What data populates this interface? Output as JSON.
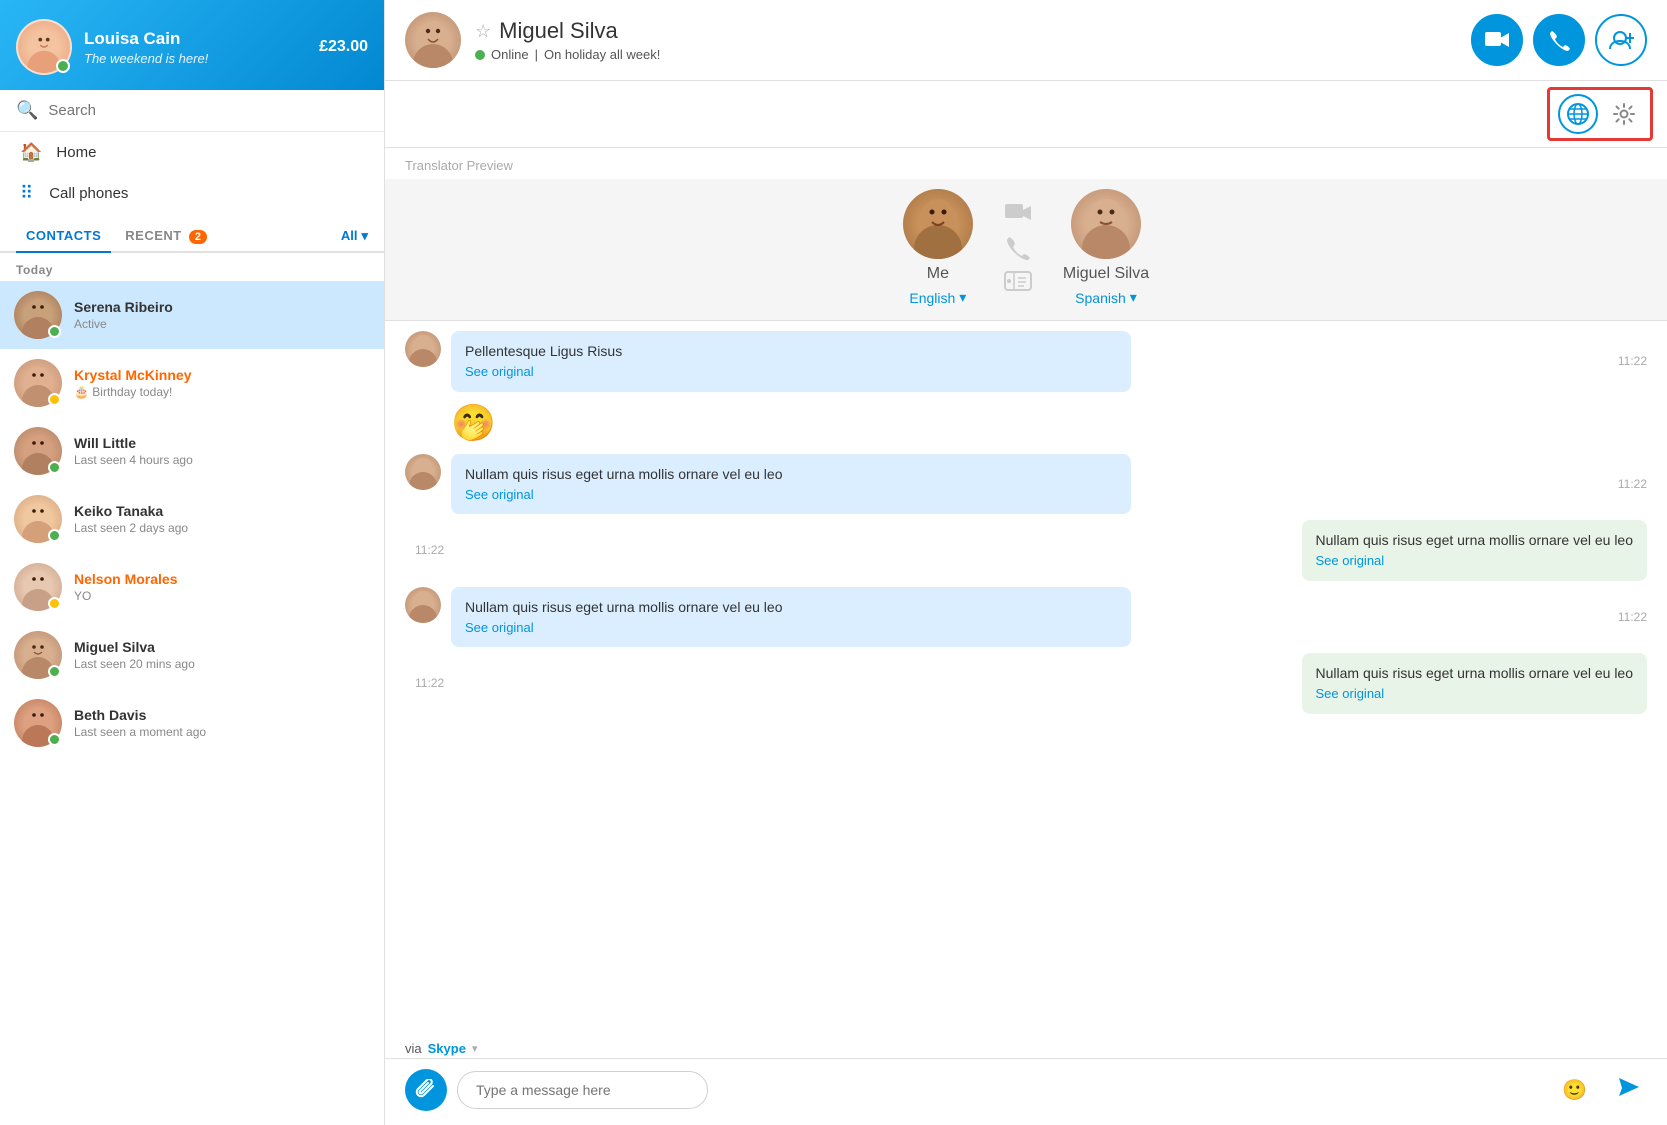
{
  "sidebar": {
    "profile": {
      "name": "Louisa Cain",
      "status": "The weekend is here!",
      "credit": "£23.00"
    },
    "search": {
      "placeholder": "Search"
    },
    "nav": {
      "home": "Home",
      "call_phones": "Call phones"
    },
    "tabs": {
      "contacts": "CONTACTS",
      "recent": "RECENT",
      "recent_badge": "2",
      "all": "All"
    },
    "section_today": "Today",
    "contacts": [
      {
        "name": "Serena Ribeiro",
        "sub": "Active",
        "status_color": "dot-green",
        "active": true,
        "name_color": ""
      },
      {
        "name": "Krystal McKinney",
        "sub": "🎂 Birthday today!",
        "status_color": "dot-yellow",
        "active": false,
        "name_color": "orange"
      },
      {
        "name": "Will Little",
        "sub": "Last seen 4 hours ago",
        "status_color": "dot-green",
        "active": false,
        "name_color": ""
      },
      {
        "name": "Keiko Tanaka",
        "sub": "Last seen 2 days ago",
        "status_color": "dot-green",
        "active": false,
        "name_color": ""
      },
      {
        "name": "Nelson Morales",
        "sub": "YO",
        "status_color": "dot-yellow",
        "active": false,
        "name_color": "orange"
      },
      {
        "name": "Miguel Silva",
        "sub": "Last seen 20 mins ago",
        "status_color": "dot-green",
        "active": false,
        "name_color": ""
      },
      {
        "name": "Beth Davis",
        "sub": "Last seen a moment ago",
        "status_color": "dot-green",
        "active": false,
        "name_color": ""
      }
    ]
  },
  "chat": {
    "contact_name": "Miguel Silva",
    "contact_status": "Online",
    "contact_status_extra": "On holiday all week!",
    "translator_preview_label": "Translator Preview",
    "me": {
      "name": "Me",
      "lang": "English",
      "lang_dropdown": "▾"
    },
    "contact": {
      "name": "Miguel Silva",
      "lang": "Spanish",
      "lang_dropdown": "▾"
    },
    "messages": [
      {
        "side": "left",
        "text": "Pellentesque Ligus Risus",
        "see_original": "See original",
        "time": "11:22",
        "has_emoji": false
      },
      {
        "side": "emoji",
        "text": "🤭",
        "time": "",
        "has_emoji": true
      },
      {
        "side": "left",
        "text": "Nullam quis risus eget urna mollis ornare vel eu leo",
        "see_original": "See original",
        "time": "11:22",
        "has_emoji": false
      },
      {
        "side": "right",
        "text": "Nullam quis risus eget urna mollis ornare vel eu leo",
        "see_original": "See original",
        "time": "11:22",
        "has_emoji": false
      },
      {
        "side": "left",
        "text": "Nullam quis risus eget urna mollis ornare vel eu leo",
        "see_original": "See original",
        "time": "11:22",
        "has_emoji": false
      },
      {
        "side": "right",
        "text": "Nullam quis risus eget urna mollis ornare vel eu leo",
        "see_original": "See original",
        "time": "11:22",
        "has_emoji": false
      }
    ],
    "via_skype": "via",
    "skype_brand": "Skype",
    "input_placeholder": "Type a message here",
    "buttons": {
      "video_call": "📹",
      "audio_call": "📞",
      "add_contact": "👤+",
      "translator": "🌐",
      "settings": "⚙"
    }
  }
}
